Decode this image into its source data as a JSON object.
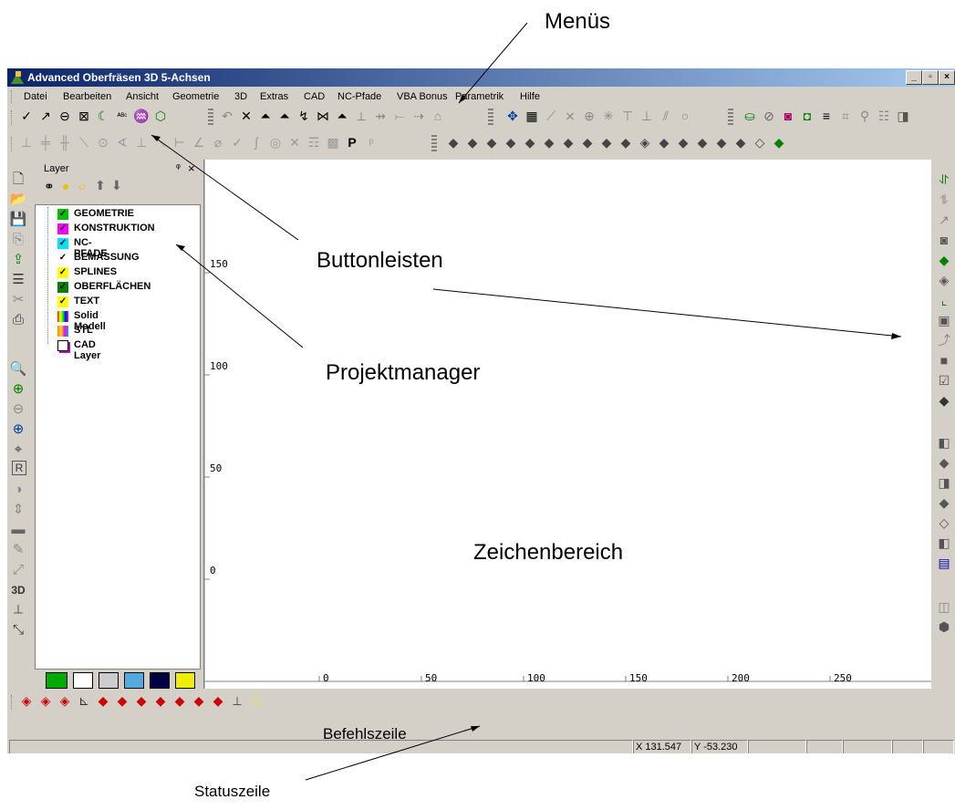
{
  "annotations": {
    "menus": "Menüs",
    "toolbars": "Buttonleisten",
    "project_manager": "Projektmanager",
    "drawing_area": "Zeichenbereich",
    "command_line": "Befehlszeile",
    "status_line": "Statuszeile"
  },
  "window": {
    "title": "Advanced Oberfräsen 3D 5-Achsen",
    "min": "_",
    "max": "▫",
    "close": "×"
  },
  "menu": [
    "Datei",
    "Bearbeiten",
    "Ansicht",
    "Geometrie",
    "3D",
    "Extras",
    "CAD",
    "NC-Pfade",
    "VBA Bonus",
    "Parametrik",
    "Hilfe"
  ],
  "layer_panel": {
    "title": "Layer",
    "pin": "ᵠ",
    "close": "×",
    "layers": [
      {
        "name": "GEOMETRIE",
        "color": "#00c000",
        "checked": true
      },
      {
        "name": "KONSTRUKTION",
        "color": "#ff00ff",
        "checked": true
      },
      {
        "name": "NC-PFADE",
        "color": "#00e0ff",
        "checked": true
      },
      {
        "name": "BEMASSUNG",
        "color": "#ffffff",
        "checked": true
      },
      {
        "name": "SPLINES",
        "color": "#ffff00",
        "checked": true
      },
      {
        "name": "OBERFLÄCHEN",
        "color": "#008000",
        "checked": true
      },
      {
        "name": "TEXT",
        "color": "#ffff00",
        "checked": true
      },
      {
        "name": "Solid Modell",
        "color": "multi",
        "checked": false
      },
      {
        "name": "STL",
        "color": "multi",
        "checked": false
      },
      {
        "name": "CAD Layer",
        "color": "stack",
        "checked": false
      }
    ]
  },
  "ruler": {
    "y_labels": [
      "150",
      "100",
      "50",
      "0"
    ],
    "x_labels": [
      "0",
      "50",
      "100",
      "150",
      "200",
      "250"
    ]
  },
  "status": {
    "x": "X 131.547",
    "y": "Y -53.230"
  }
}
